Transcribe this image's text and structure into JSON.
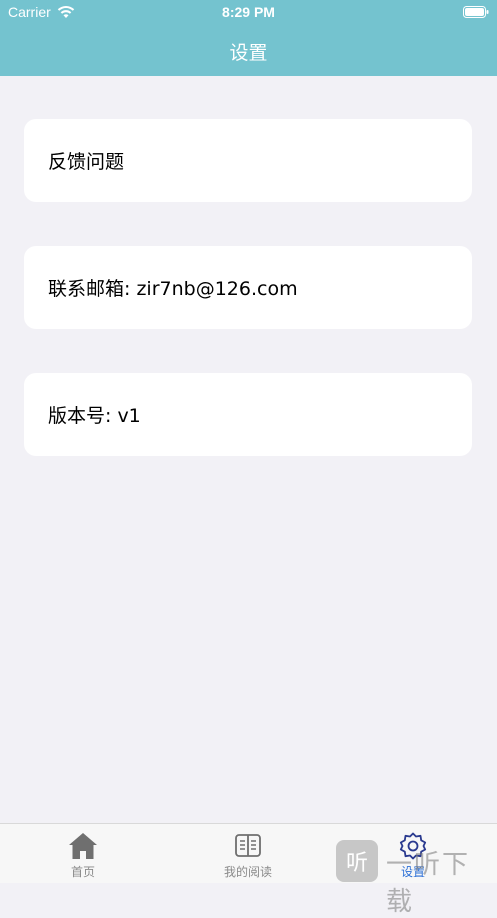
{
  "status_bar": {
    "carrier": "Carrier",
    "time": "8:29 PM",
    "icons": [
      "wifi-icon",
      "battery-icon"
    ]
  },
  "nav": {
    "title": "设置"
  },
  "settings": {
    "items": [
      {
        "label": "反馈问题"
      },
      {
        "label": "联系邮箱: zir7nb@126.com"
      },
      {
        "label": "版本号: v1"
      }
    ]
  },
  "tabbar": {
    "tabs": [
      {
        "label": "首页",
        "icon": "home-icon"
      },
      {
        "label": "我的阅读",
        "icon": "book-icon"
      },
      {
        "label": "设置",
        "icon": "gear-icon",
        "selected": true
      }
    ]
  },
  "watermark": {
    "badge": "听",
    "text": "一听下载"
  },
  "colors": {
    "header": "#74c3cf",
    "background": "#f2f1f6",
    "card": "#ffffff",
    "tab_active": "#2b6fd6",
    "tab_inactive": "#8a8a8a"
  }
}
